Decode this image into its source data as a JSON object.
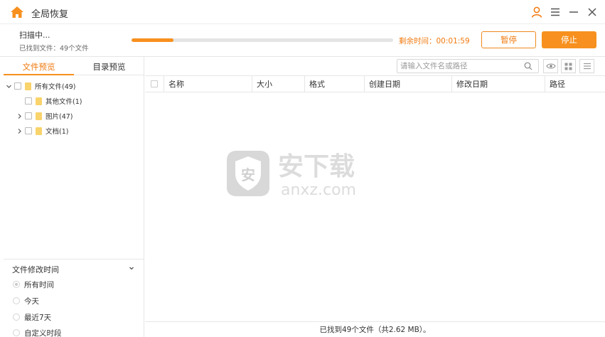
{
  "window": {
    "title": "全局恢复",
    "accent": "#f7901e"
  },
  "scan": {
    "title": "扫描中...",
    "found": "已找到文件：49个文件",
    "progress": 0.16,
    "remaining": "剩余时间：00:01:59",
    "pause_label": "暂停",
    "stop_label": "停止"
  },
  "tabs": [
    {
      "label": "文件预览",
      "active": true
    },
    {
      "label": "目录预览",
      "active": false
    }
  ],
  "tree": [
    {
      "label": "所有文件(49)",
      "expanded": true,
      "level": 0
    },
    {
      "label": "其他文件(1)",
      "level": 1
    },
    {
      "label": "图片(47)",
      "expanded": false,
      "level": 1
    },
    {
      "label": "文档(1)",
      "expanded": false,
      "level": 1
    }
  ],
  "filter": {
    "title": "文件修改时间",
    "options": [
      {
        "label": "所有时间",
        "checked": true
      },
      {
        "label": "今天",
        "checked": false
      },
      {
        "label": "最近7天",
        "checked": false
      },
      {
        "label": "自定义时段",
        "checked": false
      }
    ]
  },
  "search": {
    "placeholder": "请输入文件名或路径"
  },
  "table": {
    "columns": [
      "名称",
      "大小",
      "格式",
      "创建日期",
      "修改日期",
      "路径"
    ]
  },
  "watermark": {
    "text": "安下载",
    "domain": "anxz.com",
    "badge": "安"
  },
  "status": {
    "text": "已找到49个文件（共2.62 MB）。"
  }
}
